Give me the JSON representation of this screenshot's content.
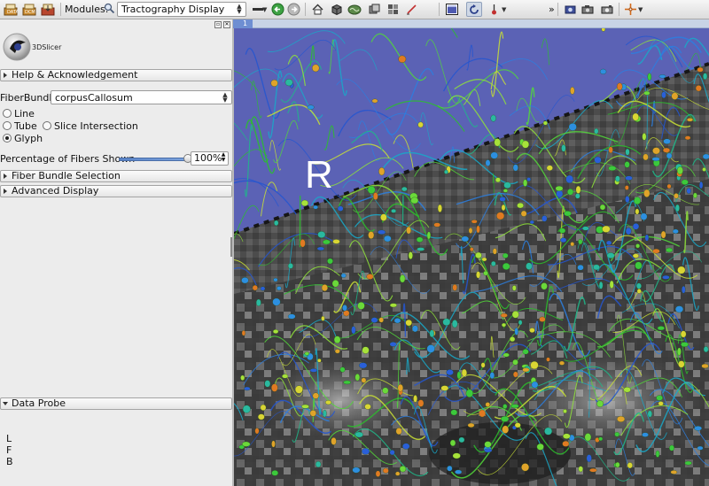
{
  "toolbar": {
    "modules_label": "Modules:",
    "module_selected": "Tractography Display",
    "icons": [
      "load-data-icon",
      "load-dicom-icon",
      "save-icon",
      "search-icon",
      "home-icon",
      "cube-icon",
      "brain-icon",
      "undo-icon",
      "redo-icon",
      "layout-icon",
      "refresh-icon",
      "mouse-mode-icon",
      "camera-icon",
      "screenshot-icon",
      "crosshair-icon"
    ],
    "overflow": "»"
  },
  "left_panel": {
    "logo_text": "3DSlicer",
    "help_section": "Help & Acknowledgement",
    "fiberbundle_label": "FiberBundle:",
    "fiberbundle_value": "corpusCallosum",
    "display_modes": [
      {
        "label": "Line",
        "selected": false
      },
      {
        "label": "Tube",
        "selected": false
      },
      {
        "label": "Slice Intersection",
        "selected": false
      },
      {
        "label": "Glyph",
        "selected": true
      }
    ],
    "percentage_label": "Percentage of Fibers Shown",
    "percentage_value": "100%",
    "percentage_fraction": 1.0,
    "fiber_selection_section": "Fiber Bundle Selection",
    "advanced_section": "Advanced Display",
    "data_probe_section": "Data Probe",
    "probe_lines": [
      "L",
      "F",
      "B"
    ]
  },
  "view": {
    "view_index": "1",
    "orientation_letter": "R",
    "background_color": "#5b62b5"
  }
}
